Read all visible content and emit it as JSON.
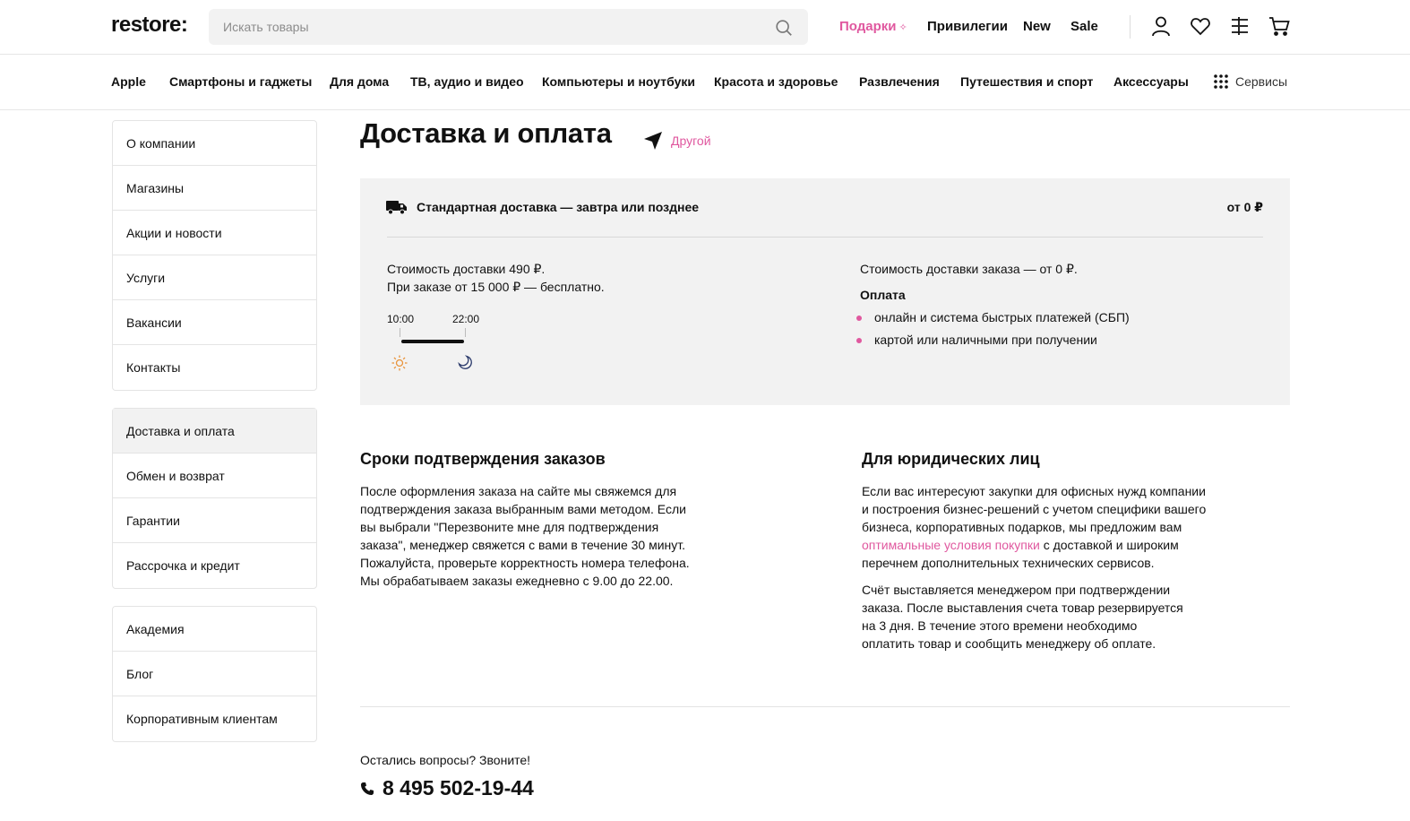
{
  "header": {
    "logo": "restore:",
    "search_placeholder": "Искать товары",
    "nav": {
      "gifts": "Подарки",
      "gifts_sparkle": "✧",
      "privileges": "Привилегии",
      "new": "New",
      "sale": "Sale"
    },
    "icons": [
      "user-icon",
      "heart-icon",
      "compare-icon",
      "cart-icon"
    ]
  },
  "categories": [
    "Apple",
    "Смартфоны и гаджеты",
    "Для дома",
    "ТВ, аудио и видео",
    "Компьютеры и ноутбуки",
    "Красота и здоровье",
    "Развлечения",
    "Путешествия и спорт",
    "Аксессуары"
  ],
  "services_label": "Сервисы",
  "sidebar": {
    "group1": [
      "О компании",
      "Магазины",
      "Акции и новости",
      "Услуги",
      "Вакансии",
      "Контакты"
    ],
    "group2": [
      "Доставка и оплата",
      "Обмен и возврат",
      "Гарантии",
      "Рассрочка и кредит"
    ],
    "group3": [
      "Академия",
      "Блог",
      "Корпоративным клиентам"
    ],
    "active": "Доставка и оплата"
  },
  "page": {
    "title": "Доставка и оплата",
    "city_link": "Другой"
  },
  "delivery": {
    "title": "Стандартная доставка — завтра или позднее",
    "price": "от 0 ₽",
    "cost_line1": "Стоимость доставки 490 ₽.",
    "cost_line2": "При заказе от 15 000 ₽ — бесплатно.",
    "time_start": "10:00",
    "time_end": "22:00",
    "order_cost": "Стоимость доставки заказа — от 0 ₽.",
    "payment_title": "Оплата",
    "payment_items": [
      "онлайн и система быстрых платежей (СБП)",
      "картой или наличными при получении"
    ]
  },
  "confirm": {
    "title": "Сроки подтверждения заказов",
    "lines": [
      "После оформления заказа на сайте мы свяжемся для",
      "подтверждения заказа выбранным вами методом. Если",
      "вы выбрали \"Перезвоните мне для подтверждения",
      "заказа\", менеджер свяжется с вами в течение 30 минут.",
      "Пожалуйста, проверьте корректность номера телефона.",
      "Мы обрабатываем заказы ежедневно с 9.00 до 22.00."
    ]
  },
  "legal": {
    "title": "Для юридических лиц",
    "p1_line1": "Если вас интересуют закупки для офисных нужд компании",
    "p1_line2": "и построения бизнес-решений с учетом специфики вашего",
    "p1_line3": "бизнеса, корпоративных подарков, мы предложим вам",
    "p1_link": "оптимальные условия покупки",
    "p1_line4_rest": " с доставкой и широким",
    "p1_line5": "перечнем дополнительных технических сервисов.",
    "p2_lines": [
      "Счёт выставляется менеджером при подтверждении",
      "заказа. После выставления счета товар резервируется",
      "на 3 дня. В течение этого времени необходимо",
      "оплатить товар и сообщить менеджеру об оплате."
    ]
  },
  "contact": {
    "question": "Остались вопросы? Звоните!",
    "phone": "8 495 502-19-44"
  },
  "colors": {
    "accent": "#e0589f",
    "panel_bg": "#f2f2f2",
    "text": "#111111",
    "sun": "#e8933a",
    "moon": "#2b3a6b"
  }
}
